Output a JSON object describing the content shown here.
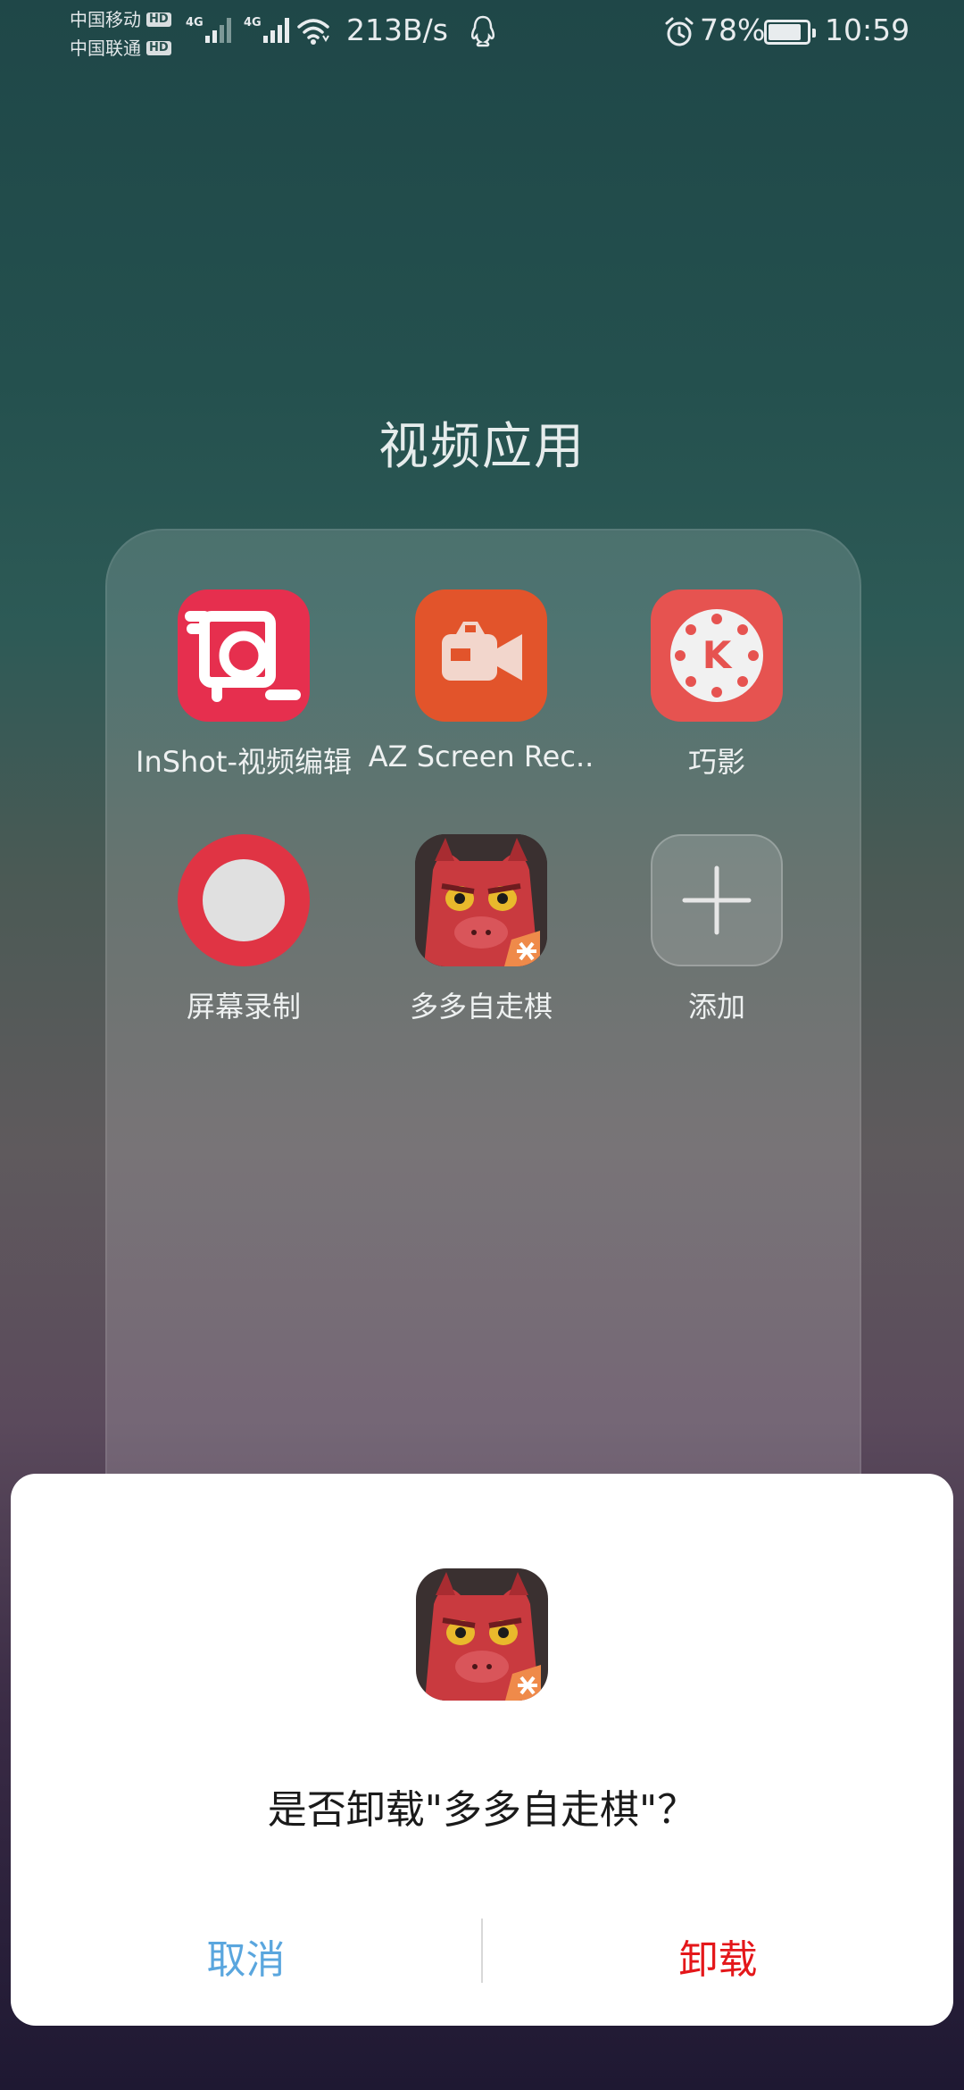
{
  "status_bar": {
    "carrier1": "中国移动",
    "carrier2": "中国联通",
    "hd_badge": "HD",
    "network1": "4G",
    "network2": "4G",
    "net_speed": "213B/s",
    "battery": "78%",
    "battery_level": 0.78,
    "time": "10:59",
    "icons": [
      "signal-icon",
      "wifi-icon",
      "qq-icon",
      "alarm-icon",
      "battery-icon"
    ]
  },
  "folder": {
    "title": "视频应用",
    "apps": [
      {
        "label": "InShot-视频编辑",
        "icon": "inshot-icon"
      },
      {
        "label": "AZ Screen Rec..",
        "icon": "camera-icon"
      },
      {
        "label": "巧影",
        "icon": "kinemaster-icon"
      },
      {
        "label": "屏幕录制",
        "icon": "record-icon"
      },
      {
        "label": "多多自走棋",
        "icon": "game-monster-icon"
      },
      {
        "label": "添加",
        "icon": "plus-icon"
      }
    ]
  },
  "dialog": {
    "message": "是否卸载\"多多自走棋\"？",
    "cancel_label": "取消",
    "uninstall_label": "卸载",
    "colors": {
      "cancel": "#5aa6de",
      "uninstall": "#e4171a"
    }
  }
}
